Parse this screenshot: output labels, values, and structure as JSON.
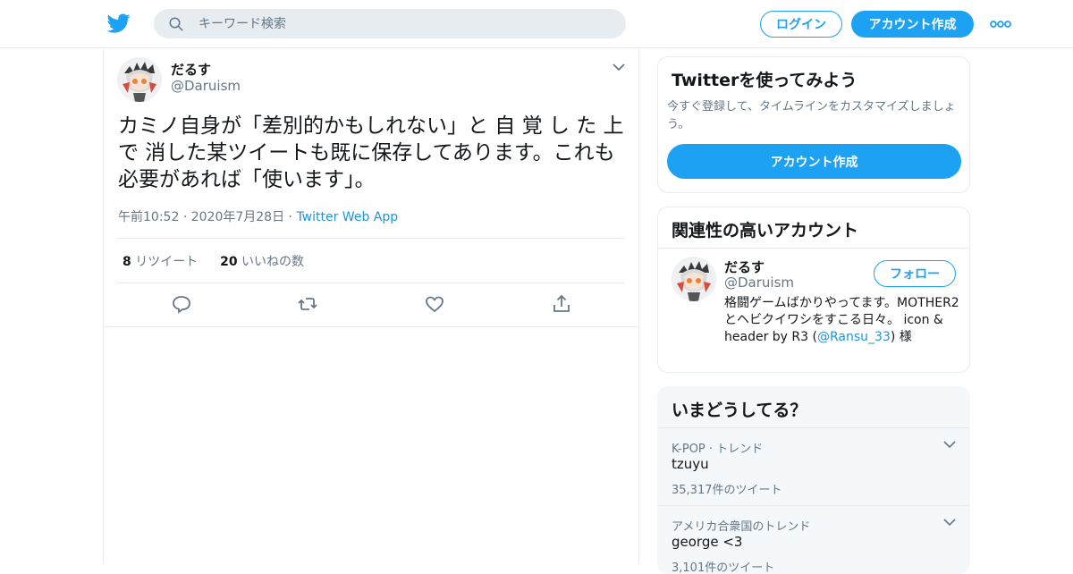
{
  "header": {
    "search_placeholder": "キーワード検索",
    "login_label": "ログイン",
    "signup_label": "アカウント作成",
    "brand_color": "#1da1f2"
  },
  "tweet": {
    "author_name": "だるす",
    "author_handle": "@Daruism",
    "text": "カミノ自身が「差別的かもしれない」と 自 覚 し た 上 で 消した某ツイートも既に保存してあります。これも必要があれば「使います」。",
    "time": "午前10:52",
    "date": "2020年7月28日",
    "source": "Twitter Web App",
    "retweet_count": "8",
    "retweet_label": "リツイート",
    "like_count": "20",
    "like_label": "いいねの数"
  },
  "signup_card": {
    "title": "Twitterを使ってみよう",
    "description": "今すぐ登録して、タイムラインをカスタマイズしましょう。",
    "button_label": "アカウント作成"
  },
  "related_card": {
    "title": "関連性の高いアカウント",
    "name": "だるす",
    "handle": "@Daruism",
    "follow_label": "フォロー",
    "bio_text": "格闘ゲームばかりやってます。MOTHER2とヘビクイワシをすこる日々。 icon & header by R3 (",
    "bio_link": "@Ransu_33",
    "bio_suffix": ") 様"
  },
  "trends_card": {
    "title": "いまどうしてる？",
    "items": [
      {
        "context": "K-POP · トレンド",
        "name": "tzuyu",
        "count": "35,317件のツイート"
      },
      {
        "context": "アメリカ合衆国のトレンド",
        "name": "george <3",
        "count": "3,101件のツイート"
      }
    ]
  }
}
